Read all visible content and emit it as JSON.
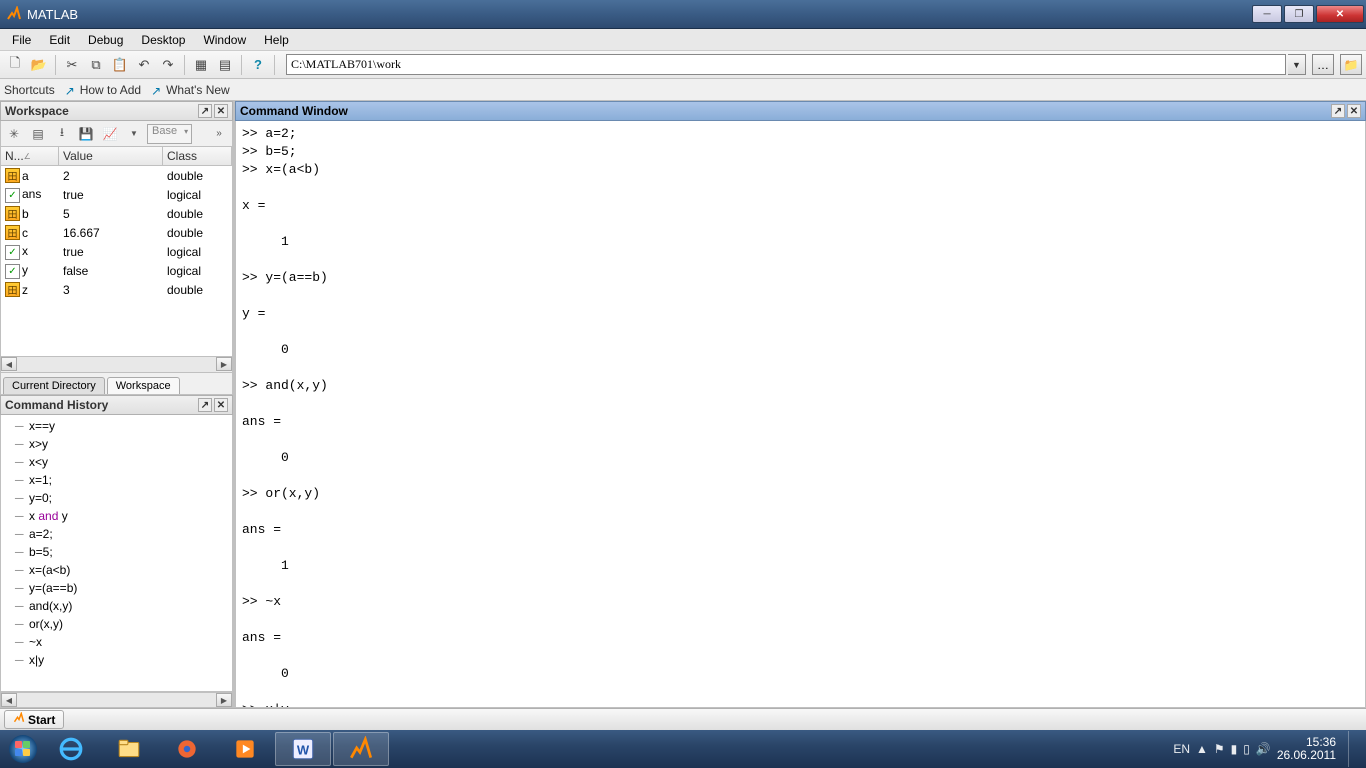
{
  "titlebar": {
    "title": "MATLAB"
  },
  "menu": [
    "File",
    "Edit",
    "Debug",
    "Desktop",
    "Window",
    "Help"
  ],
  "path": "C:\\MATLAB701\\work",
  "shortcuts": {
    "label": "Shortcuts",
    "howtoadd": "How to Add",
    "whatsnew": "What's New"
  },
  "panels": {
    "workspace": "Workspace",
    "cmdwin": "Command Window",
    "cmdhist": "Command History"
  },
  "ws_tools_select": "Base",
  "ws_cols": {
    "name": "N...",
    "value": "Value",
    "class": "Class"
  },
  "ws_vars": [
    {
      "icon": "grid",
      "name": "a",
      "value": "2",
      "class": "double"
    },
    {
      "icon": "chk",
      "name": "ans",
      "value": "true",
      "class": "logical"
    },
    {
      "icon": "grid",
      "name": "b",
      "value": "5",
      "class": "double"
    },
    {
      "icon": "grid",
      "name": "c",
      "value": "16.667",
      "class": "double"
    },
    {
      "icon": "chk",
      "name": "x",
      "value": "true",
      "class": "logical"
    },
    {
      "icon": "chk",
      "name": "y",
      "value": "false",
      "class": "logical"
    },
    {
      "icon": "grid",
      "name": "z",
      "value": "3",
      "class": "double"
    }
  ],
  "ws_tabs": {
    "curdir": "Current Directory",
    "workspace": "Workspace"
  },
  "history": [
    "x==y",
    "x>y",
    "x<y",
    "x=1;",
    "y=0;",
    "x and y",
    "a=2;",
    "b=5;",
    "x=(a<b)",
    "y=(a==b)",
    "and(x,y)",
    "or(x,y)",
    "~x",
    "x|y"
  ],
  "cmdwin_text": ">> a=2;\n>> b=5;\n>> x=(a<b)\n\nx =\n\n     1\n\n>> y=(a==b)\n\ny =\n\n     0\n\n>> and(x,y)\n\nans =\n\n     0\n\n>> or(x,y)\n\nans =\n\n     1\n\n>> ~x\n\nans =\n\n     0\n\n>> x|y",
  "startbar": {
    "start": "Start"
  },
  "tray": {
    "lang": "EN",
    "time": "15:36",
    "date": "26.06.2011"
  }
}
